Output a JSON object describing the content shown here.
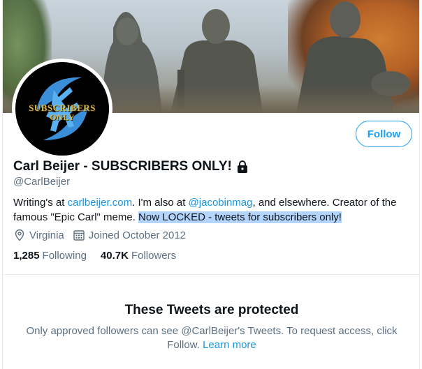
{
  "profile": {
    "name": "Carl Beijer - SUBSCRIBERS ONLY!",
    "handle": "@CarlBeijer",
    "avatar_text_line1": "SUBSCRIBERS",
    "avatar_text_line2": "ONLY",
    "follow_label": "Follow",
    "bio": {
      "p1": "Writing's at ",
      "link1": "carlbeijer.com",
      "p2": ". I'm also at ",
      "link2": "@jacobinmag",
      "p3": ", and elsewhere. Creator of the famous \"Epic Carl\" meme. ",
      "highlighted": "Now LOCKED - tweets for subscribers only!"
    },
    "location": "Virginia",
    "joined": "Joined October 2012",
    "following_count": "1,285",
    "following_label": "Following",
    "followers_count": "40.7K",
    "followers_label": "Followers"
  },
  "protected": {
    "title": "These Tweets are protected",
    "body": "Only approved followers can see @CarlBeijer's Tweets. To request access, click Follow. ",
    "learn_more": "Learn more"
  },
  "colors": {
    "accent": "#1da1f2",
    "link": "#1b95e0",
    "secondary_text": "#5b7083",
    "highlight": "#b3d4fc",
    "avatar_gold": "#d8b64a",
    "avatar_blue": "#3a8fd8"
  },
  "icons": {
    "lock": "lock-icon",
    "location": "location-pin-icon",
    "calendar": "calendar-icon"
  }
}
